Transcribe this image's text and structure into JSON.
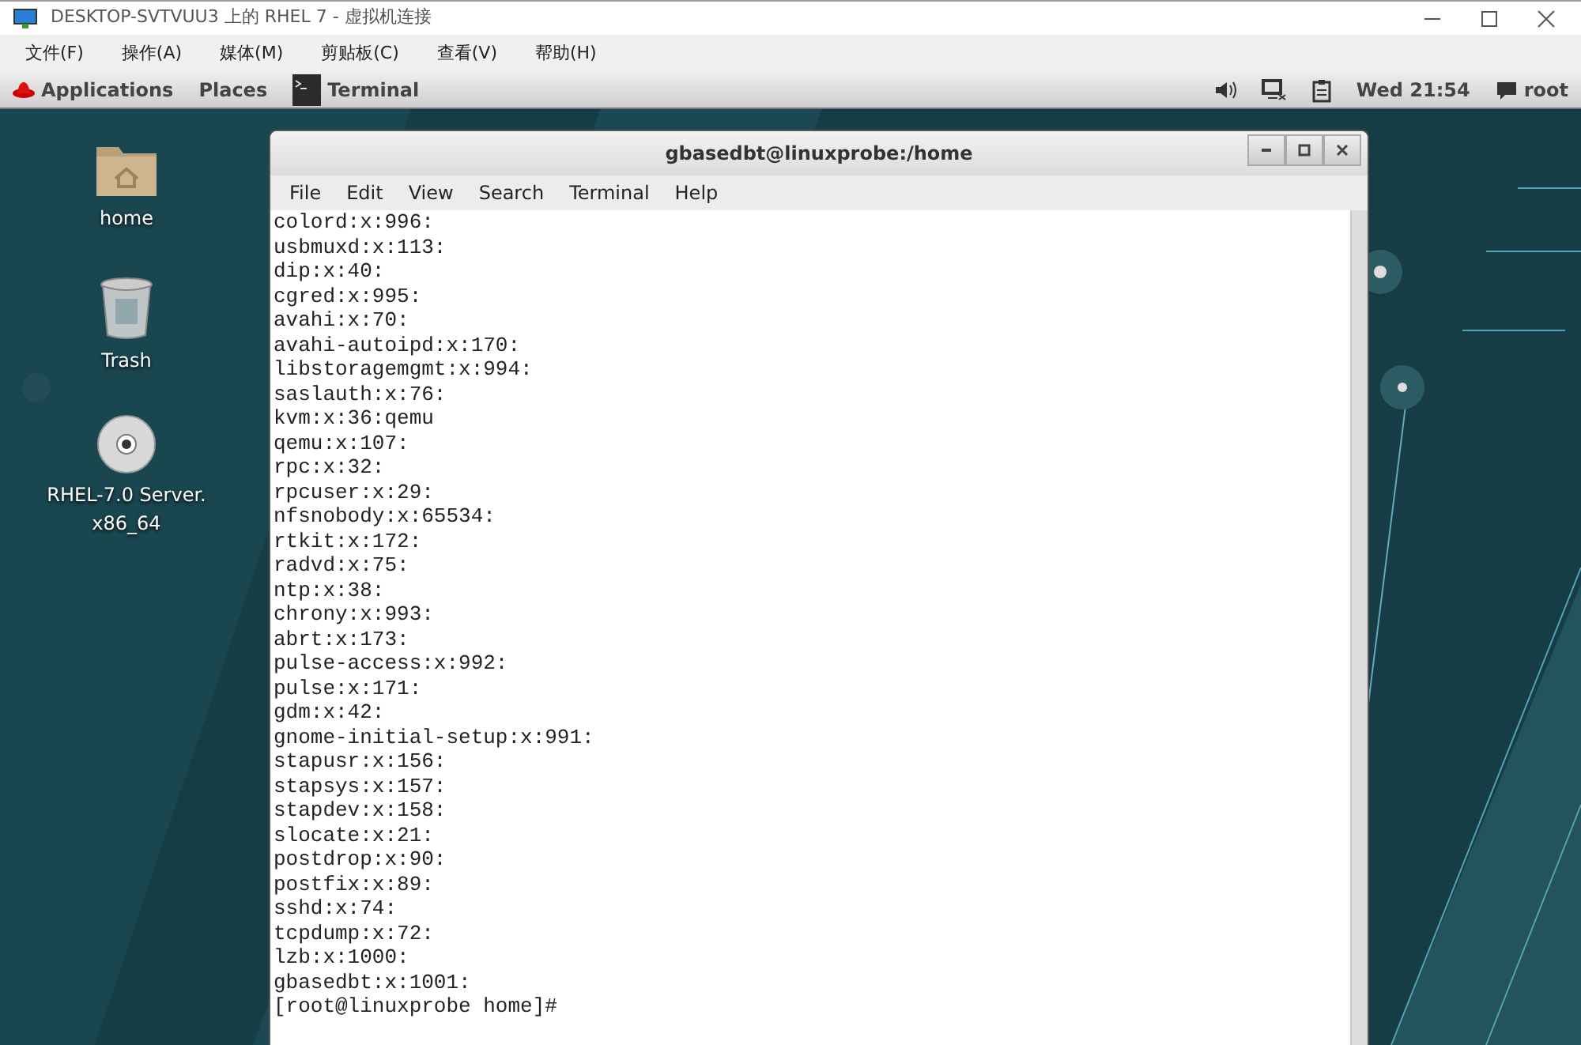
{
  "host_window": {
    "title": "DESKTOP-SVTVUU3 上的 RHEL 7 - 虚拟机连接",
    "menu": [
      "文件(F)",
      "操作(A)",
      "媒体(M)",
      "剪贴板(C)",
      "查看(V)",
      "帮助(H)"
    ]
  },
  "top_bar": {
    "applications": "Applications",
    "places": "Places",
    "active_app": "Terminal",
    "clock": "Wed 21:54",
    "user": "root"
  },
  "desktop_icons": [
    {
      "kind": "home",
      "label": "home"
    },
    {
      "kind": "trash",
      "label": "Trash"
    },
    {
      "kind": "dvd",
      "label": "RHEL-7.0 Server.\nx86_64"
    }
  ],
  "terminal": {
    "title": "gbasedbt@linuxprobe:/home",
    "menu": [
      "File",
      "Edit",
      "View",
      "Search",
      "Terminal",
      "Help"
    ],
    "lines": [
      "colord:x:996:",
      "usbmuxd:x:113:",
      "dip:x:40:",
      "cgred:x:995:",
      "avahi:x:70:",
      "avahi-autoipd:x:170:",
      "libstoragemgmt:x:994:",
      "saslauth:x:76:",
      "kvm:x:36:qemu",
      "qemu:x:107:",
      "rpc:x:32:",
      "rpcuser:x:29:",
      "nfsnobody:x:65534:",
      "rtkit:x:172:",
      "radvd:x:75:",
      "ntp:x:38:",
      "chrony:x:993:",
      "abrt:x:173:",
      "pulse-access:x:992:",
      "pulse:x:171:",
      "gdm:x:42:",
      "gnome-initial-setup:x:991:",
      "stapusr:x:156:",
      "stapsys:x:157:",
      "stapdev:x:158:",
      "slocate:x:21:",
      "postdrop:x:90:",
      "postfix:x:89:",
      "sshd:x:74:",
      "tcpdump:x:72:",
      "lzb:x:1000:",
      "gbasedbt:x:1001:",
      "[root@linuxprobe home]#"
    ]
  }
}
